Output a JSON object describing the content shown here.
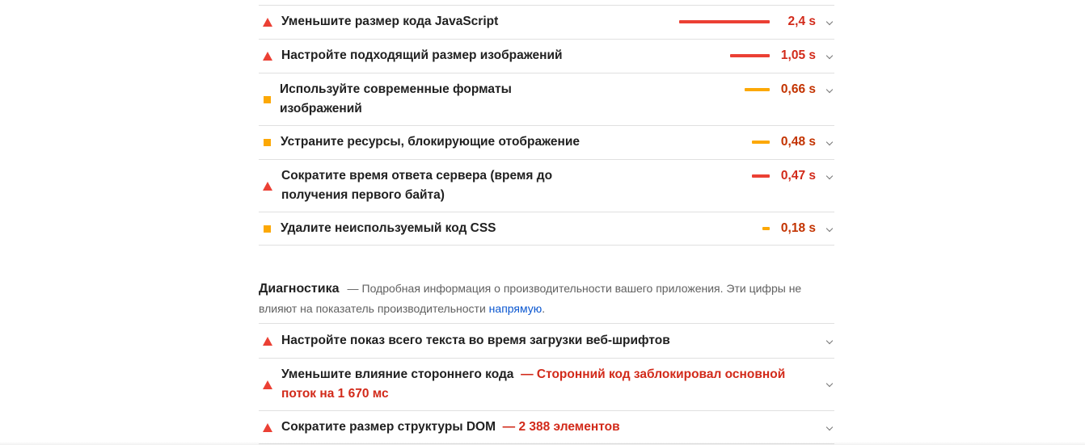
{
  "opportunities": [
    {
      "status": "fail",
      "title": "Уменьшите размер кода JavaScript",
      "value": "2,4 s",
      "bar_fraction": 1.0
    },
    {
      "status": "fail",
      "title": "Настройте подходящий размер изображений",
      "value": "1,05 s",
      "bar_fraction": 0.44
    },
    {
      "status": "average",
      "title": "Используйте современные форматы изображений",
      "value": "0,66 s",
      "bar_fraction": 0.28
    },
    {
      "status": "average",
      "title": "Устраните ресурсы, блокирующие отображение",
      "value": "0,48 s",
      "bar_fraction": 0.2
    },
    {
      "status": "fail",
      "title": "Сократите время ответа сервера (время до получения первого байта)",
      "value": "0,47 s",
      "bar_fraction": 0.2
    },
    {
      "status": "average",
      "title": "Удалите неиспользуемый код CSS",
      "value": "0,18 s",
      "bar_fraction": 0.08
    }
  ],
  "diagnostics": {
    "heading": "Диагностика",
    "dash": "—",
    "description": "Подробная информация о производительности вашего приложения. Эти цифры не влияют на показатель производительности",
    "link_text": "напрямую",
    "period": ".",
    "items": [
      {
        "status": "fail",
        "title": "Настройте показ всего текста во время загрузки веб-шрифтов",
        "detail": ""
      },
      {
        "status": "fail",
        "title": "Уменьшите влияние стороннего кода",
        "detail": "— Сторонний код заблокировал основной поток на 1 670 мс"
      },
      {
        "status": "fail",
        "title": "Сократите размер структуры DOM",
        "detail": "— 2 388 элементов"
      }
    ]
  },
  "colors": {
    "fail": "#eb4034",
    "average": "#fca805",
    "link": "#0b57d0"
  },
  "icons": {
    "fail": "warning-triangle-icon",
    "average": "orange-square-icon",
    "expand": "chevron-down-icon"
  }
}
